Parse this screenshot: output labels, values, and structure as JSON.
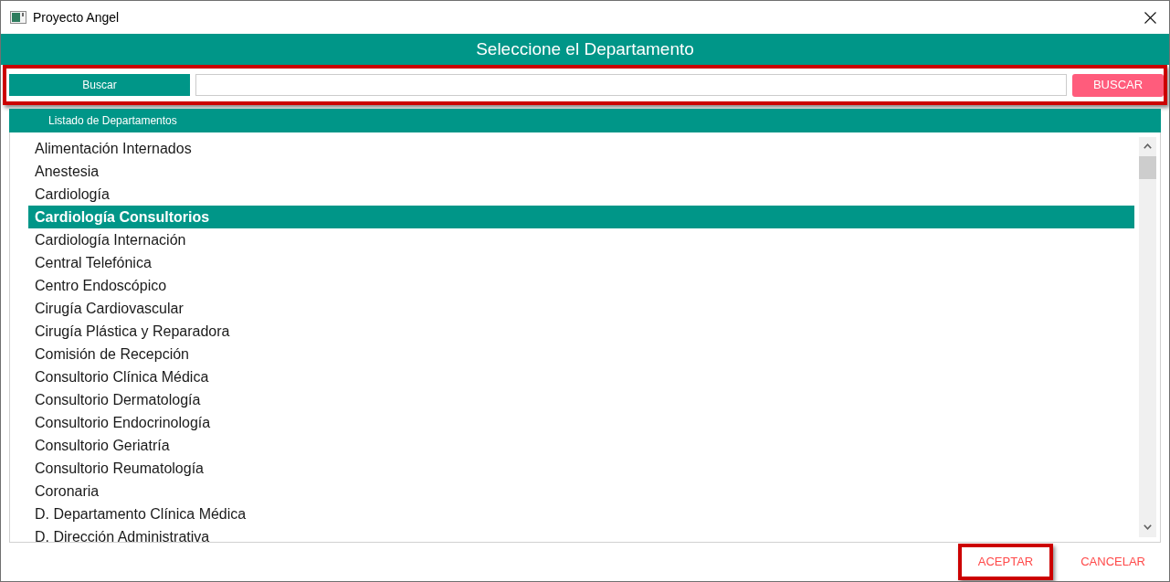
{
  "window": {
    "title": "Proyecto Angel"
  },
  "header": {
    "title": "Seleccione el Departamento"
  },
  "search": {
    "label": "Buscar",
    "button": "BUSCAR",
    "highlighted": true
  },
  "list": {
    "title": "Listado de Departamentos",
    "items": [
      {
        "label": "Alimentación Internados",
        "selected": false
      },
      {
        "label": "Anestesia",
        "selected": false
      },
      {
        "label": "Cardiología",
        "selected": false
      },
      {
        "label": "Cardiología Consultorios",
        "selected": true
      },
      {
        "label": "Cardiología Internación",
        "selected": false
      },
      {
        "label": "Central Telefónica",
        "selected": false
      },
      {
        "label": "Centro Endoscópico",
        "selected": false
      },
      {
        "label": "Cirugía Cardiovascular",
        "selected": false
      },
      {
        "label": "Cirugía Plástica y Reparadora",
        "selected": false
      },
      {
        "label": "Comisión de Recepción",
        "selected": false
      },
      {
        "label": "Consultorio Clínica Médica",
        "selected": false
      },
      {
        "label": "Consultorio Dermatología",
        "selected": false
      },
      {
        "label": "Consultorio Endocrinología",
        "selected": false
      },
      {
        "label": "Consultorio Geriatría",
        "selected": false
      },
      {
        "label": "Consultorio Reumatología",
        "selected": false
      },
      {
        "label": "Coronaria",
        "selected": false
      },
      {
        "label": "D. Departamento Clínica Médica",
        "selected": false
      },
      {
        "label": "D. Dirección Administrativa",
        "selected": false
      }
    ]
  },
  "buttons": [
    {
      "label": "ACEPTAR",
      "highlighted": true
    },
    {
      "label": "CANCELAR",
      "highlighted": false
    }
  ]
}
